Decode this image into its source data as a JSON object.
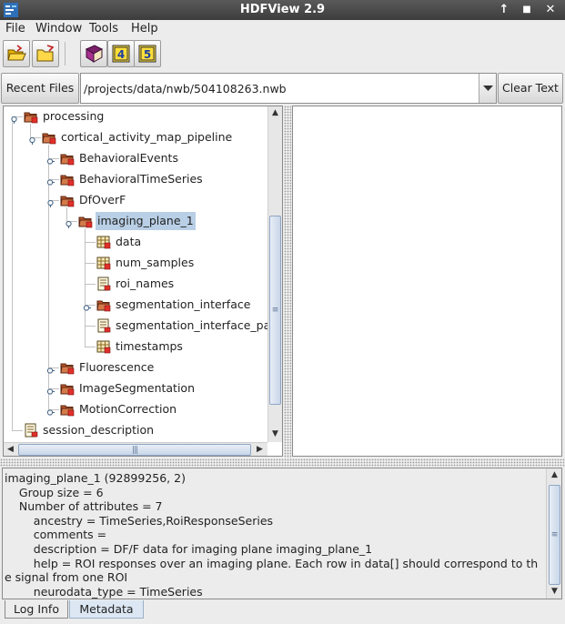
{
  "window": {
    "title": "HDFView 2.9",
    "controls": [
      "↑",
      "■",
      "✕"
    ]
  },
  "menu": [
    "File",
    "Window",
    "Tools",
    "Help"
  ],
  "toolbar": {
    "buttons": [
      "open-file-icon",
      "close-file-icon",
      "help-book-icon",
      "hdf4-library-icon",
      "hdf5-library-icon"
    ],
    "hdf4_label": "4",
    "hdf5_label": "5"
  },
  "pathbar": {
    "recent_files_label": "Recent Files",
    "file_path": "/projects/data/nwb/504108263.nwb",
    "clear_text_label": "Clear Text"
  },
  "tree": [
    {
      "label": "processing",
      "type": "group",
      "expanded": true
    },
    {
      "label": "cortical_activity_map_pipeline",
      "type": "group",
      "expanded": true
    },
    {
      "label": "BehavioralEvents",
      "type": "group",
      "expanded": false
    },
    {
      "label": "BehavioralTimeSeries",
      "type": "group",
      "expanded": false
    },
    {
      "label": "DfOverF",
      "type": "group",
      "expanded": true
    },
    {
      "label": "imaging_plane_1",
      "type": "group",
      "expanded": true,
      "selected": true
    },
    {
      "label": "data",
      "type": "dataset"
    },
    {
      "label": "num_samples",
      "type": "dataset"
    },
    {
      "label": "roi_names",
      "type": "text"
    },
    {
      "label": "segmentation_interface",
      "type": "group",
      "expanded": false
    },
    {
      "label": "segmentation_interface_pa",
      "type": "text"
    },
    {
      "label": "timestamps",
      "type": "dataset"
    },
    {
      "label": "Fluorescence",
      "type": "group",
      "expanded": false
    },
    {
      "label": "ImageSegmentation",
      "type": "group",
      "expanded": false
    },
    {
      "label": "MotionCorrection",
      "type": "group",
      "expanded": false
    },
    {
      "label": "session_description",
      "type": "text"
    }
  ],
  "info": {
    "lines": [
      "imaging_plane_1 (92899256, 2)",
      "    Group size = 6",
      "    Number of attributes = 7",
      "        ancestry = TimeSeries,RoiResponseSeries",
      "        comments = ",
      "        description = DF/F data for imaging plane imaging_plane_1",
      "        help = ROI responses over an imaging plane. Each row in data[] should correspond to th",
      "e signal from one ROI",
      "        neurodata_type = TimeSeries"
    ]
  },
  "tabs": [
    {
      "label": "Log Info",
      "active": true
    },
    {
      "label": "Metadata",
      "active": false
    }
  ],
  "colors": {
    "titlebar": "#3c3c3c",
    "selection": "#b8cfe5",
    "folder": "#b8572b",
    "scroll_thumb": "#c8d6e8"
  }
}
